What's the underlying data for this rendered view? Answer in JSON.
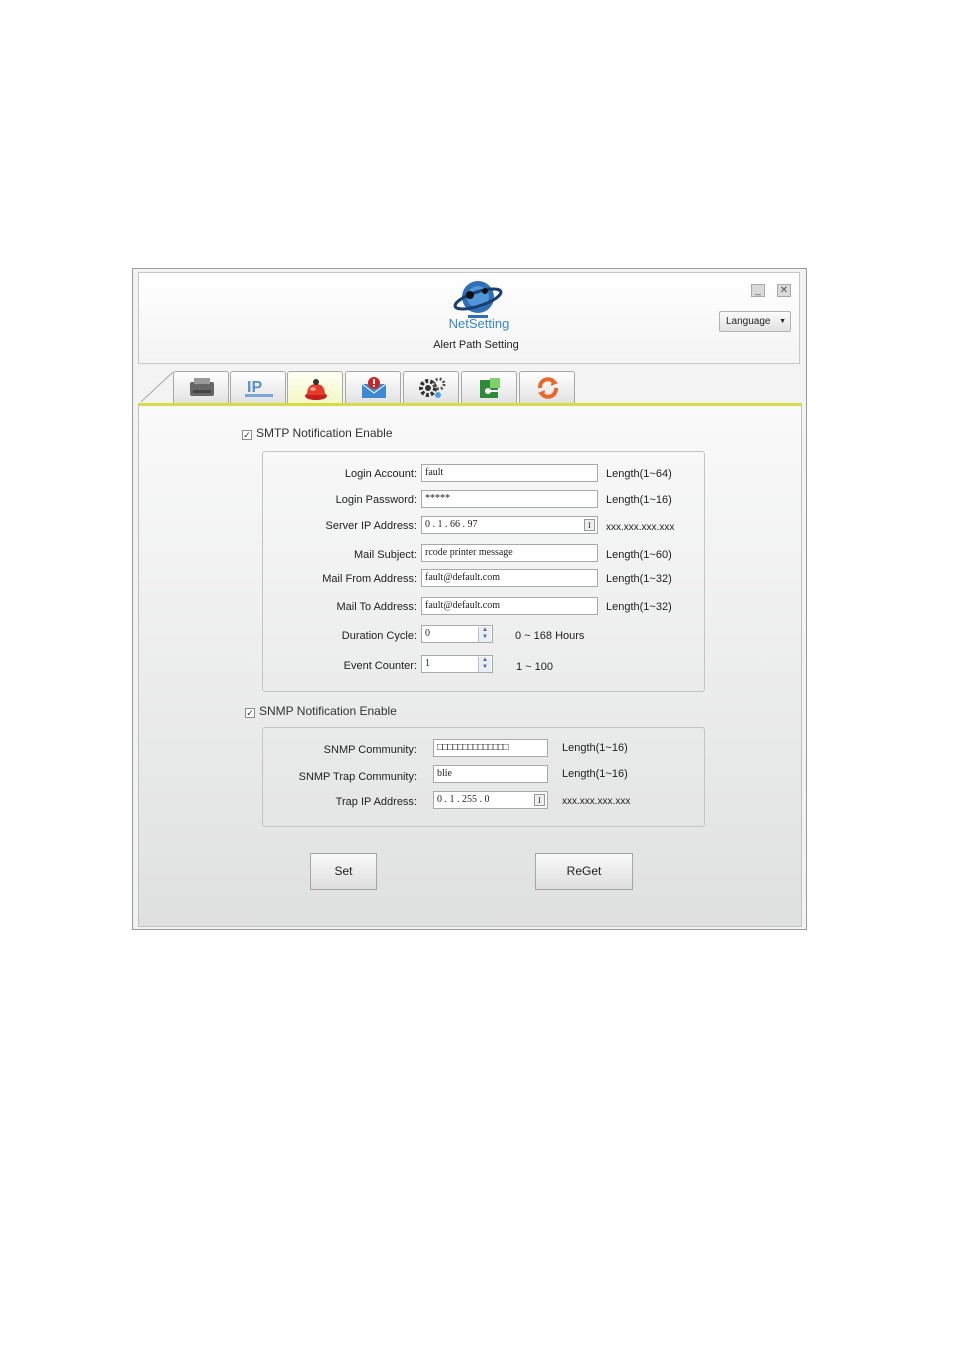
{
  "header": {
    "brand": "NetSetting",
    "subtitle": "Alert Path Setting",
    "language_label": "Language",
    "minimize": "_",
    "close": "✕"
  },
  "tabs": [
    {
      "icon": "printer-icon"
    },
    {
      "icon": "ip-network-icon",
      "label": "IP"
    },
    {
      "icon": "alarm-bell-icon",
      "active": true
    },
    {
      "icon": "mail-alert-icon"
    },
    {
      "icon": "gears-icon"
    },
    {
      "icon": "key-security-icon"
    },
    {
      "icon": "refresh-icon"
    }
  ],
  "smtp": {
    "enable_label": "SMTP Notification Enable",
    "checked": "✓",
    "fields": [
      {
        "label": "Login Account:",
        "value": "fault",
        "hint": "Length(1~64)"
      },
      {
        "label": "Login Password:",
        "value": "*****",
        "hint": "Length(1~16)"
      },
      {
        "label": "Server IP Address:",
        "value": "0 . 1 . 66 . 97",
        "hint": "xxx.xxx.xxx.xxx"
      },
      {
        "label": "Mail Subject:",
        "value": "rcode printer message",
        "hint": "Length(1~60)"
      },
      {
        "label": "Mail From Address:",
        "value": "fault@default.com",
        "hint": "Length(1~32)"
      },
      {
        "label": "Mail To Address:",
        "value": "fault@default.com",
        "hint": "Length(1~32)"
      },
      {
        "label": "Duration Cycle:",
        "value": "0",
        "hint": "0 ~ 168 Hours"
      },
      {
        "label": "Event Counter:",
        "value": "1",
        "hint": "1 ~ 100"
      }
    ]
  },
  "snmp": {
    "enable_label": "SNMP Notification Enable",
    "checked": "✓",
    "fields": [
      {
        "label": "SNMP Community:",
        "value": "□□□□□□□□□□□□□□",
        "hint": "Length(1~16)"
      },
      {
        "label": "SNMP Trap Community:",
        "value": "blie",
        "hint": "Length(1~16)"
      },
      {
        "label": "Trap IP Address:",
        "value": "0 . 1 . 255 . 0",
        "hint": "xxx.xxx.xxx.xxx"
      }
    ]
  },
  "buttons": {
    "set": "Set",
    "reget": "ReGet"
  },
  "colors": {
    "accent_bar": "#d6db4a",
    "brand": "#3a86c8"
  }
}
